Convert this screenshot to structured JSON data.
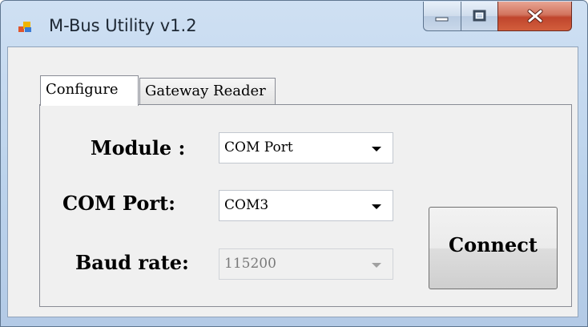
{
  "window": {
    "title": "M-Bus Utility v1.2",
    "icon": "app-window-icon",
    "controls": {
      "minimize": "minimize-icon",
      "maximize": "maximize-icon",
      "close": "close-icon"
    }
  },
  "tabs": [
    {
      "label": "Configure",
      "active": true
    },
    {
      "label": "Gateway Reader",
      "active": false
    }
  ],
  "form": {
    "module_label": "Module :",
    "module_value": "COM Port",
    "com_port_label": "COM Port:",
    "com_port_value": "COM3",
    "baud_label": "Baud rate:",
    "baud_value": "115200",
    "baud_enabled": false
  },
  "connect_label": "Connect",
  "colors": {
    "close_button": "#c0452d",
    "frame": "#bcd3ec"
  }
}
